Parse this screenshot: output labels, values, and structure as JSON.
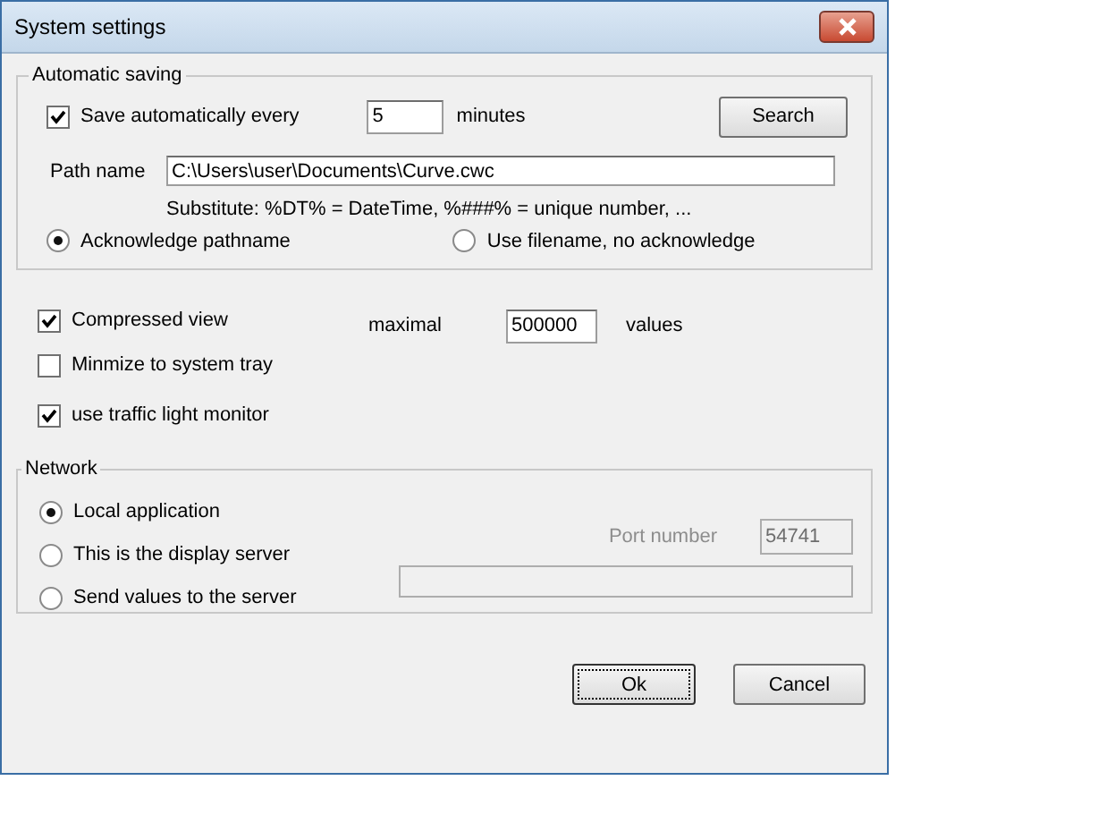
{
  "window": {
    "title": "System settings"
  },
  "auto_saving": {
    "title": "Automatic saving",
    "save_every": {
      "label": "Save automatically every",
      "checked": true
    },
    "interval": "5",
    "unit": "minutes",
    "search_button": "Search",
    "path_label": "Path name",
    "path_value": "C:\\Users\\user\\Documents\\Curve.cwc",
    "hint": "Substitute: %DT% = DateTime, %###% = unique number, ...",
    "choices": [
      {
        "label": "Acknowledge pathname",
        "selected": true
      },
      {
        "label": "Use filename, no acknowledge",
        "selected": false
      }
    ]
  },
  "options": [
    {
      "label": "Compressed view",
      "checked": true
    },
    {
      "label": "Minmize to system tray",
      "checked": false
    },
    {
      "label": "use traffic light monitor",
      "checked": true
    }
  ],
  "maximal": {
    "label": "maximal",
    "value": "500000",
    "unit": "values"
  },
  "network": {
    "title": "Network",
    "modes": [
      {
        "label": "Local application",
        "selected": true
      },
      {
        "label": "This is the display server",
        "selected": false
      },
      {
        "label": "Send values to the server",
        "selected": false
      }
    ],
    "port_label": "Port number",
    "port_value": "54741",
    "port_disabled": true,
    "server_disabled": true
  },
  "buttons": [
    {
      "label": "Ok",
      "default": true
    },
    {
      "label": "Cancel",
      "default": false
    }
  ]
}
